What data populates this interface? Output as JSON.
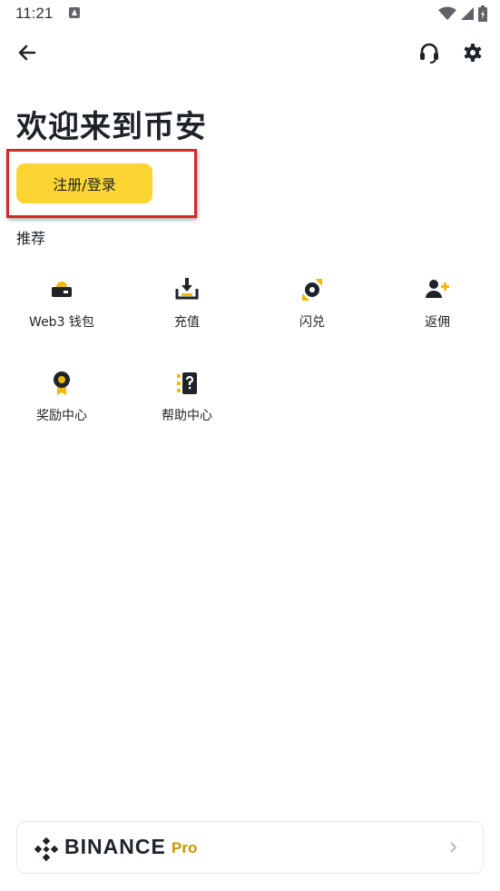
{
  "status_bar": {
    "time": "11:21",
    "icons": [
      "notification-a-icon",
      "wifi-icon",
      "signal-icon",
      "battery-icon"
    ]
  },
  "top_bar": {
    "icons": [
      "back-arrow-icon",
      "headset-icon",
      "gear-icon"
    ]
  },
  "welcome": {
    "title": "欢迎来到币安",
    "register_button": "注册/登录"
  },
  "recommend": {
    "section_title": "推荐",
    "items": [
      {
        "label": "Web3 钱包",
        "icon": "wallet-icon"
      },
      {
        "label": "充值",
        "icon": "deposit-icon"
      },
      {
        "label": "闪兑",
        "icon": "convert-icon"
      },
      {
        "label": "返佣",
        "icon": "referral-icon"
      },
      {
        "label": "奖励中心",
        "icon": "reward-icon"
      },
      {
        "label": "帮助中心",
        "icon": "help-icon"
      }
    ]
  },
  "promo": {
    "brand": "BINANCE",
    "suffix": "Pro",
    "icon": "chevron-right-icon"
  },
  "colors": {
    "accent": "#fcd535",
    "text": "#1e2329",
    "pro": "#c99400",
    "highlight": "#d9262b"
  }
}
